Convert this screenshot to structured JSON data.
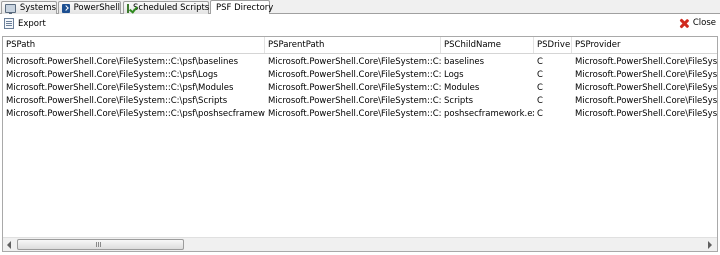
{
  "tabs": [
    {
      "label": "Systems",
      "icon": "systems-icon",
      "active": false
    },
    {
      "label": "PowerShell",
      "icon": "powershell-icon",
      "active": false
    },
    {
      "label": "Scheduled Scripts",
      "icon": "scheduled-scripts-icon",
      "active": false
    },
    {
      "label": "PSF Directory",
      "icon": "",
      "active": true
    }
  ],
  "toolbar": {
    "export_label": "Export",
    "close_label": "Close"
  },
  "columns": [
    "PSPath",
    "PSParentPath",
    "PSChildName",
    "PSDrive",
    "PSProvider"
  ],
  "rows": [
    [
      "Microsoft.PowerShell.Core\\FileSystem::C:\\psf\\baselines",
      "Microsoft.PowerShell.Core\\FileSystem::C:\\psf",
      "baselines",
      "C",
      "Microsoft.PowerShell.Core\\FileSystem"
    ],
    [
      "Microsoft.PowerShell.Core\\FileSystem::C:\\psf\\Logs",
      "Microsoft.PowerShell.Core\\FileSystem::C:\\psf",
      "Logs",
      "C",
      "Microsoft.PowerShell.Core\\FileSystem"
    ],
    [
      "Microsoft.PowerShell.Core\\FileSystem::C:\\psf\\Modules",
      "Microsoft.PowerShell.Core\\FileSystem::C:\\psf",
      "Modules",
      "C",
      "Microsoft.PowerShell.Core\\FileSystem"
    ],
    [
      "Microsoft.PowerShell.Core\\FileSystem::C:\\psf\\Scripts",
      "Microsoft.PowerShell.Core\\FileSystem::C:\\psf",
      "Scripts",
      "C",
      "Microsoft.PowerShell.Core\\FileSystem"
    ],
    [
      "Microsoft.PowerShell.Core\\FileSystem::C:\\psf\\poshsecframework.exe",
      "Microsoft.PowerShell.Core\\FileSystem::C:\\psf",
      "poshsecframework.exe",
      "C",
      "Microsoft.PowerShell.Core\\FileSystem"
    ]
  ]
}
